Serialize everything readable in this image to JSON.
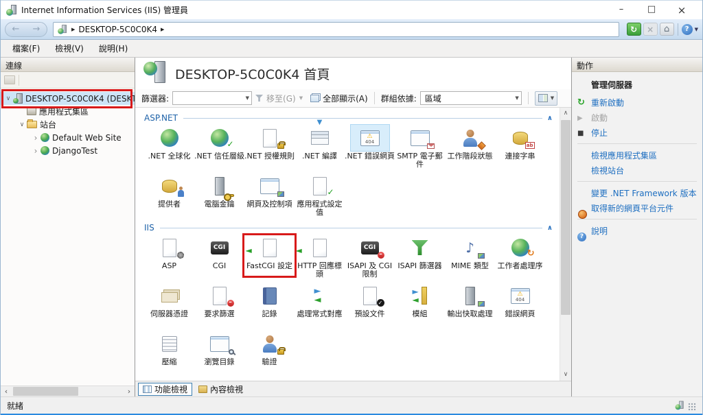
{
  "window": {
    "title": "Internet Information Services (IIS) 管理員",
    "status": "就緒"
  },
  "navigation": {
    "breadcrumb_root": "DESKTOP-5C0C0K4"
  },
  "menu": {
    "items": [
      "檔案(F)",
      "檢視(V)",
      "說明(H)"
    ]
  },
  "sidebar": {
    "header": "連線",
    "tree": [
      {
        "label": "DESKTOP-5C0C0K4 (DESKT",
        "level": 0,
        "icon": "server",
        "expanded": true,
        "selected": true,
        "annotated": true
      },
      {
        "label": "應用程式集區",
        "level": 1,
        "icon": "app-pools"
      },
      {
        "label": "站台",
        "level": 1,
        "icon": "sites-folder",
        "expanded": true
      },
      {
        "label": "Default Web Site",
        "level": 2,
        "icon": "site-globe",
        "expanded": false
      },
      {
        "label": "DjangoTest",
        "level": 2,
        "icon": "site-globe",
        "expanded": false
      }
    ]
  },
  "main": {
    "page_title": "DESKTOP-5C0C0K4 首頁",
    "filter_bar": {
      "filter_label": "篩選器:",
      "go_label": "移至(G)",
      "show_all_label": "全部顯示(A)",
      "group_by_label": "群組依據:",
      "group_by_value": "區域"
    },
    "sections": [
      {
        "title": "ASP.NET",
        "items": [
          {
            "label": ".NET 全球化",
            "icon": "globe"
          },
          {
            "label": ".NET 信任層級",
            "icon": "globe-check"
          },
          {
            "label": ".NET 授權規則",
            "icon": "page-lock"
          },
          {
            "label": ".NET 編譯",
            "icon": "stack-compile"
          },
          {
            "label": ".NET 錯誤網頁",
            "icon": "window-404",
            "selected": true
          },
          {
            "label": "SMTP 電子郵件",
            "icon": "window-mail"
          },
          {
            "label": "工作階段狀態",
            "icon": "person-session"
          },
          {
            "label": "連接字串",
            "icon": "db-ab"
          },
          {
            "label": "提供者",
            "icon": "db-person"
          },
          {
            "label": "電腦金鑰",
            "icon": "server-key"
          },
          {
            "label": "網頁及控制項",
            "icon": "window-controls"
          },
          {
            "label": "應用程式設定值",
            "icon": "page-settings"
          }
        ]
      },
      {
        "title": "IIS",
        "items": [
          {
            "label": "ASP",
            "icon": "page-asp"
          },
          {
            "label": "CGI",
            "icon": "cgi-box"
          },
          {
            "label": "FastCGI 設定",
            "icon": "page-fastcgi",
            "annotated": true
          },
          {
            "label": "HTTP 回應標頭",
            "icon": "page-headers"
          },
          {
            "label": "ISAPI 及 CGI 限制",
            "icon": "cgi-restrict"
          },
          {
            "label": "ISAPI 篩選器",
            "icon": "funnel-globe"
          },
          {
            "label": "MIME 類型",
            "icon": "mime-note"
          },
          {
            "label": "工作者處理序",
            "icon": "globe-refresh"
          },
          {
            "label": "伺服器憑證",
            "icon": "certificates"
          },
          {
            "label": "要求篩選",
            "icon": "request-filter"
          },
          {
            "label": "記錄",
            "icon": "log-book"
          },
          {
            "label": "處理常式對應",
            "icon": "handler-map"
          },
          {
            "label": "預設文件",
            "icon": "doc-check"
          },
          {
            "label": "模組",
            "icon": "modules"
          },
          {
            "label": "輸出快取處理",
            "icon": "output-cache"
          },
          {
            "label": "錯誤網頁",
            "icon": "window-404"
          },
          {
            "label": "壓縮",
            "icon": "compress"
          },
          {
            "label": "瀏覽目錄",
            "icon": "dir-browse"
          },
          {
            "label": "驗證",
            "icon": "person-lock"
          }
        ]
      }
    ],
    "view_tabs": [
      {
        "label": "功能檢視",
        "icon": "features-view",
        "selected": true
      },
      {
        "label": "內容檢視",
        "icon": "content-view",
        "selected": false
      }
    ]
  },
  "actions": {
    "header": "動作",
    "groups": [
      {
        "title": "管理伺服器",
        "items": [
          {
            "label": "重新啟動",
            "icon": "restart"
          },
          {
            "label": "啟動",
            "icon": "start",
            "disabled": true
          },
          {
            "label": "停止",
            "icon": "stop"
          }
        ]
      },
      {
        "items": [
          {
            "label": "檢視應用程式集區"
          },
          {
            "label": "檢視站台"
          }
        ]
      },
      {
        "items": [
          {
            "label": "變更 .NET Framework 版本"
          },
          {
            "label": "取得新的網頁平台元件",
            "icon": "web-platform"
          }
        ]
      },
      {
        "items": [
          {
            "label": "說明",
            "icon": "help"
          }
        ]
      }
    ]
  },
  "colors": {
    "annotation_red": "#d81a1a",
    "selected_item_bg": "#d8edfb",
    "link_blue": "#1d6ec0",
    "section_blue": "#1e62a8"
  }
}
